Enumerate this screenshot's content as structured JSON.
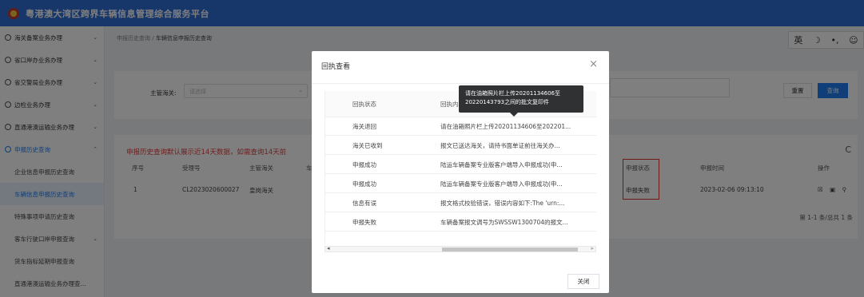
{
  "app": {
    "title": "粤港澳大湾区跨界车辆信息管理综合服务平台"
  },
  "sidebar": {
    "items": [
      {
        "label": "海关备案业务办理",
        "chev": "⌄"
      },
      {
        "label": "省口岸办业务办理",
        "chev": "⌄"
      },
      {
        "label": "省交警局业务办理",
        "chev": "⌄"
      },
      {
        "label": "边检业务办理",
        "chev": "⌄"
      },
      {
        "label": "直通港澳运输业务办理",
        "chev": "⌄"
      },
      {
        "label": "申报历史查询",
        "chev": "⌃"
      }
    ],
    "subs": [
      {
        "label": "企业信息申报历史查询"
      },
      {
        "label": "车辆信息申报历史查询"
      },
      {
        "label": "特殊事项申请历史查询"
      },
      {
        "label": "客车行驶口岸申报查询",
        "chev": "⌄"
      },
      {
        "label": "货车指标延期申报查询"
      },
      {
        "label": "直通港澳运输业务办理查..."
      }
    ]
  },
  "breadcrumb": {
    "first": "申报历史查询",
    "sep": "/",
    "current": "车辆信息申报历史查询"
  },
  "ime": {
    "a": "英",
    "b": "☽",
    "c": "•,",
    "d": "☺"
  },
  "filter": {
    "label": "主管海关:",
    "placeholder": "请选择",
    "caret": "⌄",
    "reset": "重置",
    "query": "查询"
  },
  "table": {
    "notice": "申报历史查询默认展示近14天数据，如需查询14天前",
    "refresh": "C",
    "headers": {
      "seq": "序号",
      "recv": "受理号",
      "customs": "主管海关",
      "car": "车",
      "status": "申报状态",
      "time": "申报时间",
      "op": "操作"
    },
    "row": {
      "seq": "1",
      "recv": "CL2023020600027",
      "customs": "皇岗海关",
      "status": "申报失败",
      "time": "2023-02-06 09:13:10",
      "op": "☒ ▣ ⚲"
    },
    "pager": "第 1-1 条/总共 1 条"
  },
  "modal": {
    "title": "回执查看",
    "close": "×",
    "headers": {
      "status": "回执状态",
      "content": "回执内容"
    },
    "rows": [
      {
        "status": "海关退回",
        "content": "请在油箱照片栏上传20201134606至202201..."
      },
      {
        "status": "海关已收到",
        "content": "报文已送达海关，请持书面单证前往海关办..."
      },
      {
        "status": "申报成功",
        "content": "陆运车辆备案专业版客户端导入申报成功(申..."
      },
      {
        "status": "申报成功",
        "content": "陆运车辆备案专业版客户端导入申报成功(申..."
      },
      {
        "status": "信息有误",
        "content": "报文格式校验错误，错误内容如下:The 'urn:..."
      },
      {
        "status": "申报失败",
        "content": "车辆备案报文调号为SWSSW1300704的报文..."
      }
    ],
    "scroll_left": "◂",
    "scroll_right": "▸",
    "close_btn": "关闭"
  },
  "tooltip": {
    "line1": "请在油箱照片栏上传20201134606至",
    "line2": "20220143793之间的批文复印件"
  }
}
